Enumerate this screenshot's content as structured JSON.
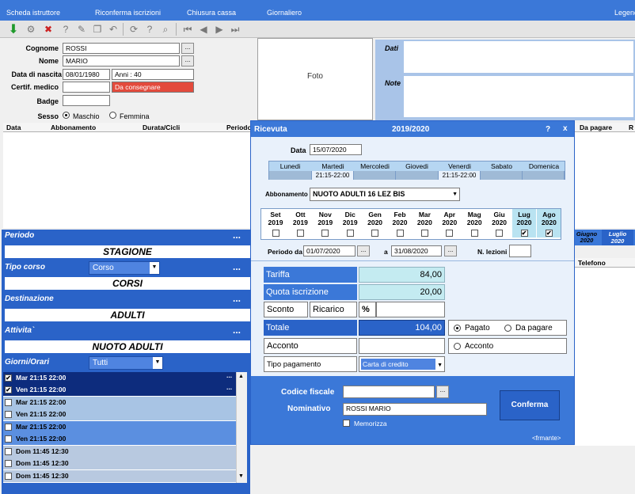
{
  "menu": {
    "items": [
      "Scheda istruttore",
      "Riconferma iscrizioni",
      "Chiusura cassa",
      "Giornaliero"
    ],
    "right": "Legend"
  },
  "form": {
    "cognome_label": "Cognome",
    "cognome": "ROSSI",
    "nome_label": "Nome",
    "nome": "MARIO",
    "nascita_label": "Data di nascita",
    "nascita": "08/01/1980",
    "anni": "Anni : 40",
    "certif_label": "Certif. medico",
    "certif_status": "Da consegnare",
    "badge_label": "Badge",
    "sesso_label": "Sesso",
    "maschio": "Maschio",
    "femmina": "Femmina",
    "dots": "..."
  },
  "foto": "Foto",
  "dati_label": "Dati",
  "note_label": "Note",
  "grid": {
    "headers": [
      "Data",
      "Abbonamento",
      "Durata/Cicli",
      "Periodo"
    ],
    "right_headers": [
      "Da pagare",
      "R"
    ]
  },
  "left": {
    "periodo_label": "Periodo",
    "periodo": "STAGIONE",
    "tipo_label": "Tipo corso",
    "tipo_combo": "Corso",
    "tipo": "CORSI",
    "dest_label": "Destinazione",
    "dest": "ADULTI",
    "att_label": "Attivita`",
    "att": "NUOTO ADULTI",
    "giorni_label": "Giorni/Orari",
    "giorni_combo": "Tutti",
    "slots": [
      {
        "text": "Mar 21:15 22:00",
        "checked": true
      },
      {
        "text": "Ven 21:15 22:00",
        "checked": true
      },
      {
        "text": "Mar 21:15 22:00",
        "checked": false
      },
      {
        "text": "Ven 21:15 22:00",
        "checked": false
      },
      {
        "text": "Mar 21:15 22:00",
        "checked": false
      },
      {
        "text": "Ven 21:15 22:00",
        "checked": false
      },
      {
        "text": "Dom 11:45 12:30",
        "checked": false
      },
      {
        "text": "Dom 11:45 12:30",
        "checked": false
      },
      {
        "text": "Dom 11:45 12:30",
        "checked": false
      }
    ]
  },
  "right_side": {
    "tab1": "Giugno 2020",
    "tab2": "Luglio 2020",
    "telefono": "Telefono"
  },
  "modal": {
    "title": "Ricevuta",
    "season": "2019/2020",
    "help": "?",
    "close": "x",
    "data_label": "Data",
    "data": "15/07/2020",
    "days": [
      "Lunedi",
      "Martedi",
      "Mercoledi",
      "Giovedi",
      "Venerdi",
      "Sabato",
      "Domenica"
    ],
    "day_times": [
      "",
      "21:15-22:00",
      "",
      "",
      "21:15-22:00",
      "",
      ""
    ],
    "abbonamento_label": "Abbonamento",
    "abbonamento": "NUOTO ADULTI 16 LEZ BIS",
    "months": [
      {
        "m": "Set",
        "y": "2019",
        "checked": false
      },
      {
        "m": "Ott",
        "y": "2019",
        "checked": false
      },
      {
        "m": "Nov",
        "y": "2019",
        "checked": false
      },
      {
        "m": "Dic",
        "y": "2019",
        "checked": false
      },
      {
        "m": "Gen",
        "y": "2020",
        "checked": false
      },
      {
        "m": "Feb",
        "y": "2020",
        "checked": false
      },
      {
        "m": "Mar",
        "y": "2020",
        "checked": false
      },
      {
        "m": "Apr",
        "y": "2020",
        "checked": false
      },
      {
        "m": "Mag",
        "y": "2020",
        "checked": false
      },
      {
        "m": "Giu",
        "y": "2020",
        "checked": false
      },
      {
        "m": "Lug",
        "y": "2020",
        "checked": true
      },
      {
        "m": "Ago",
        "y": "2020",
        "checked": true
      }
    ],
    "periodo_da_label": "Periodo da",
    "periodo_da": "01/07/2020",
    "a_label": "a",
    "periodo_a": "31/08/2020",
    "lezioni_label": "N. lezioni",
    "lezioni": "",
    "tariffa_label": "Tariffa",
    "tariffa": "84,00",
    "quota_label": "Quota iscrizione",
    "quota": "20,00",
    "sconto_label": "Sconto",
    "ricarico_label": "Ricarico",
    "percent": "%",
    "totale_label": "Totale",
    "totale": "104,00",
    "pagato": "Pagato",
    "da_pagare": "Da pagare",
    "acconto_label": "Acconto",
    "acconto_radio": "Acconto",
    "tipo_pag_label": "Tipo pagamento",
    "tipo_pag": "Carta di credito",
    "cf_label": "Codice fiscale",
    "nominativo_label": "Nominativo",
    "nominativo": "ROSSI MARIO",
    "memorizza": "Memorizza",
    "conferma": "Conferma",
    "footer": "<frmante>"
  }
}
